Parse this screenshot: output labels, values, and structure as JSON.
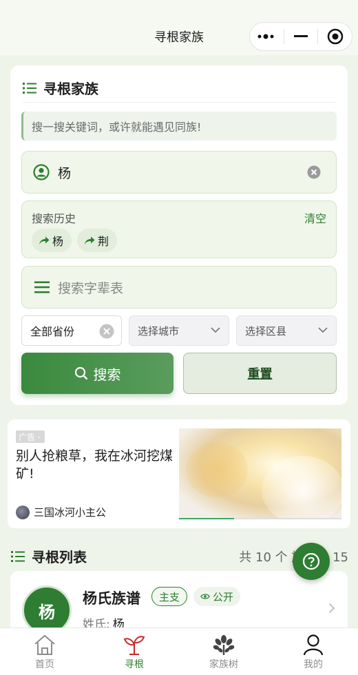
{
  "header": {
    "title": "寻根家族"
  },
  "search_card": {
    "title": "寻根家族",
    "notice": "搜一搜关键词，或许就能遇见同族!",
    "name_value": "杨",
    "history": {
      "title": "搜索历史",
      "clear_label": "清空",
      "items": [
        "杨",
        "荆"
      ]
    },
    "generation_placeholder": "搜索字辈表",
    "province": "全部省份",
    "city_placeholder": "选择城市",
    "district_placeholder": "选择区县",
    "search_button": "搜索",
    "reset_button": "重置"
  },
  "ad": {
    "badge": "广告",
    "title": "别人抢粮草，我在冰河挖煤矿!",
    "author": "三国冰河小主公",
    "carousel_progress": 0.34
  },
  "list": {
    "title": "寻根列表",
    "count_text": "共 10 个  族谱数 15",
    "items": [
      {
        "avatar_char": "杨",
        "name": "杨氏族谱",
        "tag_branch": "主支",
        "tag_public": "公开",
        "surname_label": "姓氏:",
        "surname_value": "杨"
      }
    ]
  },
  "tabbar": {
    "items": [
      {
        "label": "首页",
        "icon": "home-icon"
      },
      {
        "label": "寻根",
        "icon": "sprout-icon",
        "active": true
      },
      {
        "label": "家族树",
        "icon": "tree-icon"
      },
      {
        "label": "我的",
        "icon": "user-icon"
      }
    ]
  },
  "colors": {
    "primary": "#2e7d32",
    "background": "#eef4e9"
  }
}
